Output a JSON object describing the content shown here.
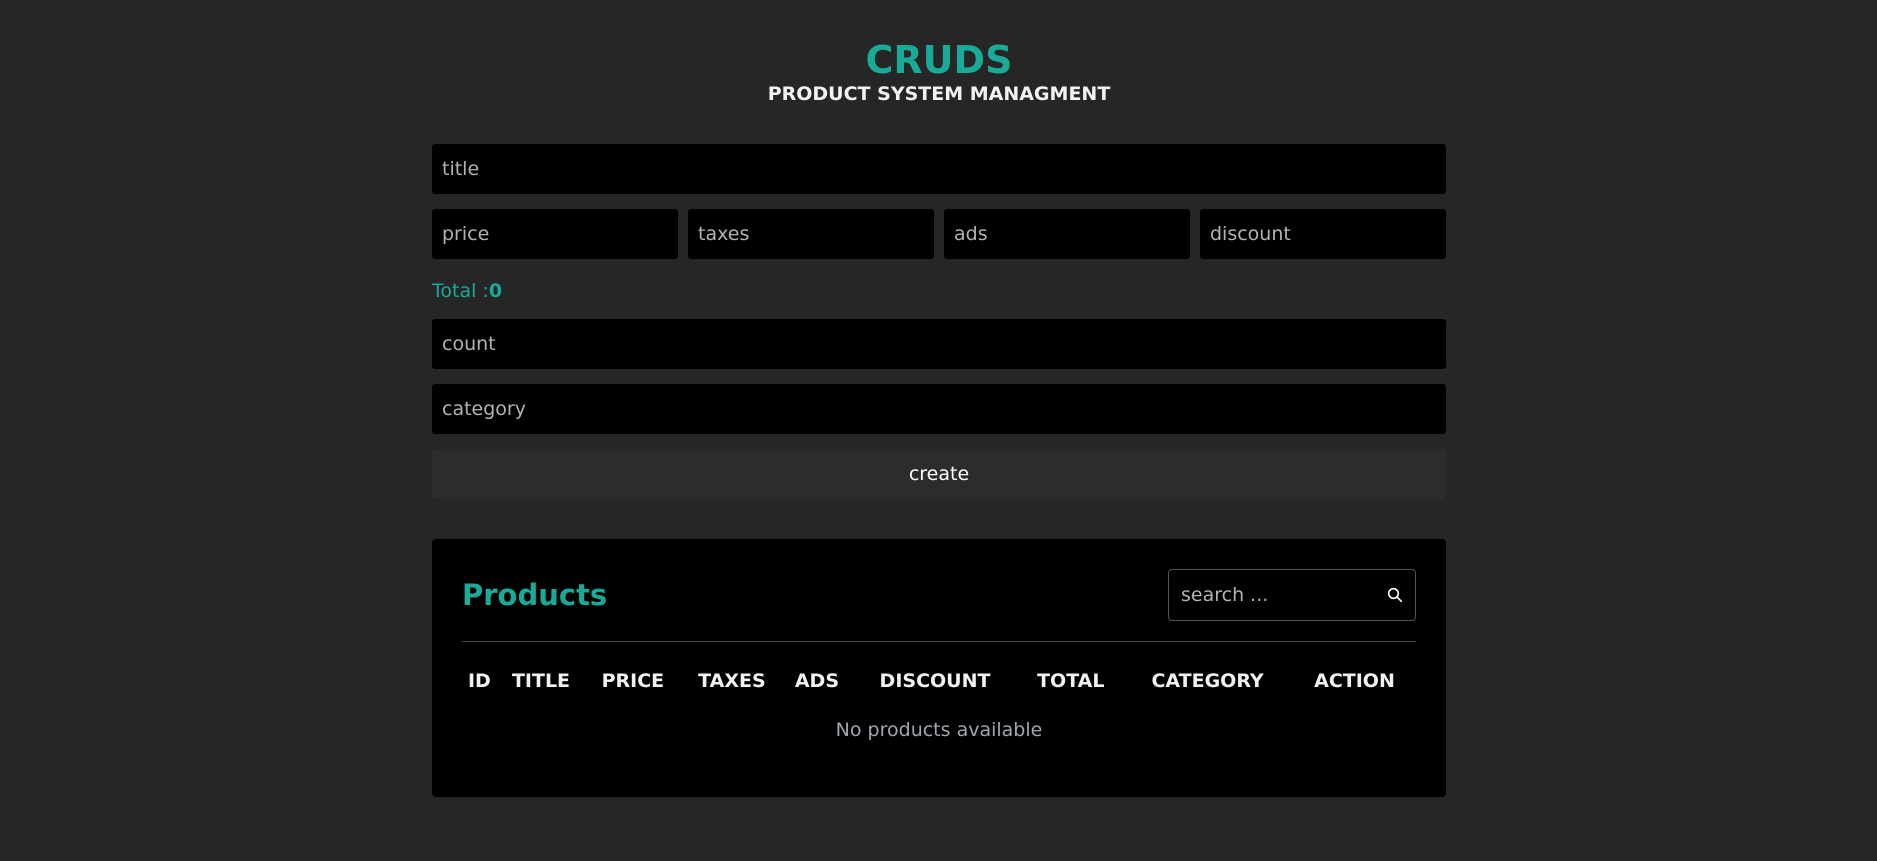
{
  "header": {
    "title": "CRUDS",
    "subtitle": "PRODUCT SYSTEM MANAGMENT"
  },
  "form": {
    "title_placeholder": "title",
    "price_placeholder": "price",
    "taxes_placeholder": "taxes",
    "ads_placeholder": "ads",
    "discount_placeholder": "discount",
    "total_label": "Total :",
    "total_value": "0",
    "count_placeholder": "count",
    "category_placeholder": "category",
    "create_label": "create"
  },
  "products": {
    "title": "Products",
    "search_placeholder": "search ...",
    "columns": [
      "ID",
      "TITLE",
      "PRICE",
      "TAXES",
      "ADS",
      "DISCOUNT",
      "TOTAL",
      "CATEGORY",
      "ACTION"
    ],
    "empty_message": "No products available"
  },
  "colors": {
    "accent": "#1aab98",
    "background": "#262626",
    "panel": "#000000"
  },
  "icons": {
    "search": "search-icon"
  }
}
